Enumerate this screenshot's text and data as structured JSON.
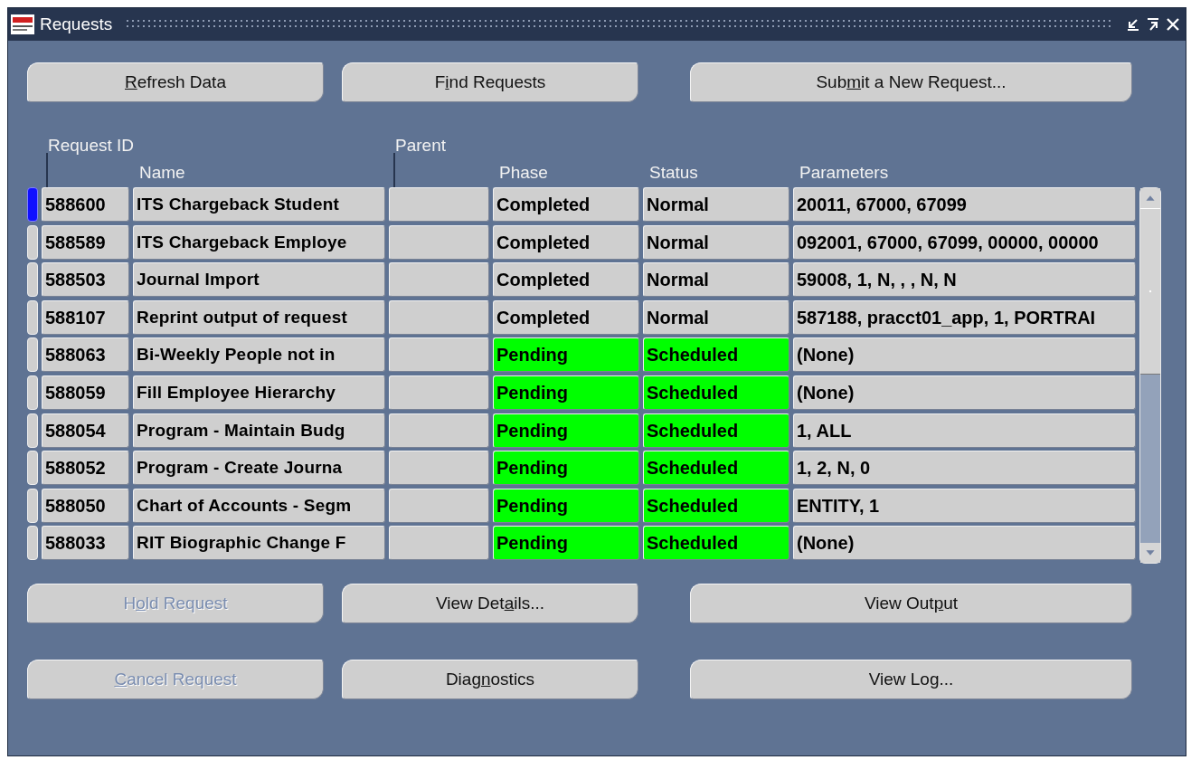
{
  "window": {
    "title": "Requests"
  },
  "top_buttons": [
    {
      "key": "R",
      "post": "efresh Data",
      "disabled": false
    },
    {
      "pre": "F",
      "key": "i",
      "post": "nd Requests",
      "disabled": false
    },
    {
      "pre": "Sub",
      "key": "m",
      "post": "it a New Request...",
      "disabled": false
    }
  ],
  "table": {
    "columns": {
      "request_id": "Request ID",
      "parent": "Parent",
      "name": "Name",
      "phase": "Phase",
      "status": "Status",
      "parameters": "Parameters"
    },
    "rows": [
      {
        "selected": true,
        "id": "588600",
        "name": "ITS Chargeback Student",
        "parent": "",
        "phase": "Completed",
        "status": "Normal",
        "highlighted": false,
        "parameters": "20011, 67000, 67099"
      },
      {
        "selected": false,
        "id": "588589",
        "name": "ITS Chargeback Employe",
        "parent": "",
        "phase": "Completed",
        "status": "Normal",
        "highlighted": false,
        "parameters": "092001, 67000, 67099, 00000, 00000"
      },
      {
        "selected": false,
        "id": "588503",
        "name": "Journal Import",
        "parent": "",
        "phase": "Completed",
        "status": "Normal",
        "highlighted": false,
        "parameters": "59008, 1, N, , , N, N"
      },
      {
        "selected": false,
        "id": "588107",
        "name": "Reprint output of request",
        "parent": "",
        "phase": "Completed",
        "status": "Normal",
        "highlighted": false,
        "parameters": "587188, pracct01_app, 1, PORTRAI"
      },
      {
        "selected": false,
        "id": "588063",
        "name": "Bi-Weekly People not in",
        "parent": "",
        "phase": "Pending",
        "status": "Scheduled",
        "highlighted": true,
        "parameters": "(None)"
      },
      {
        "selected": false,
        "id": "588059",
        "name": "Fill Employee Hierarchy",
        "parent": "",
        "phase": "Pending",
        "status": "Scheduled",
        "highlighted": true,
        "parameters": "(None)"
      },
      {
        "selected": false,
        "id": "588054",
        "name": "Program - Maintain Budg",
        "parent": "",
        "phase": "Pending",
        "status": "Scheduled",
        "highlighted": true,
        "parameters": "1, ALL"
      },
      {
        "selected": false,
        "id": "588052",
        "name": "Program - Create Journa",
        "parent": "",
        "phase": "Pending",
        "status": "Scheduled",
        "highlighted": true,
        "parameters": "1, 2, N, 0"
      },
      {
        "selected": false,
        "id": "588050",
        "name": "Chart of Accounts - Segm",
        "parent": "",
        "phase": "Pending",
        "status": "Scheduled",
        "highlighted": true,
        "parameters": "ENTITY, 1"
      },
      {
        "selected": false,
        "id": "588033",
        "name": "RIT Biographic Change F",
        "parent": "",
        "phase": "Pending",
        "status": "Scheduled",
        "highlighted": true,
        "parameters": "(None)"
      }
    ]
  },
  "bottom_buttons": [
    {
      "pre": "H",
      "key": "o",
      "post": "ld Request",
      "disabled": true
    },
    {
      "pre": "View Det",
      "key": "a",
      "post": "ils...",
      "disabled": false
    },
    {
      "pre": "View Out",
      "key": "p",
      "post": "ut",
      "disabled": false
    },
    {
      "key": "C",
      "post": "ancel Request",
      "disabled": true
    },
    {
      "pre": "Diag",
      "key": "n",
      "post": "ostics",
      "disabled": false
    },
    {
      "pre": "View Log...",
      "disabled": false
    }
  ]
}
